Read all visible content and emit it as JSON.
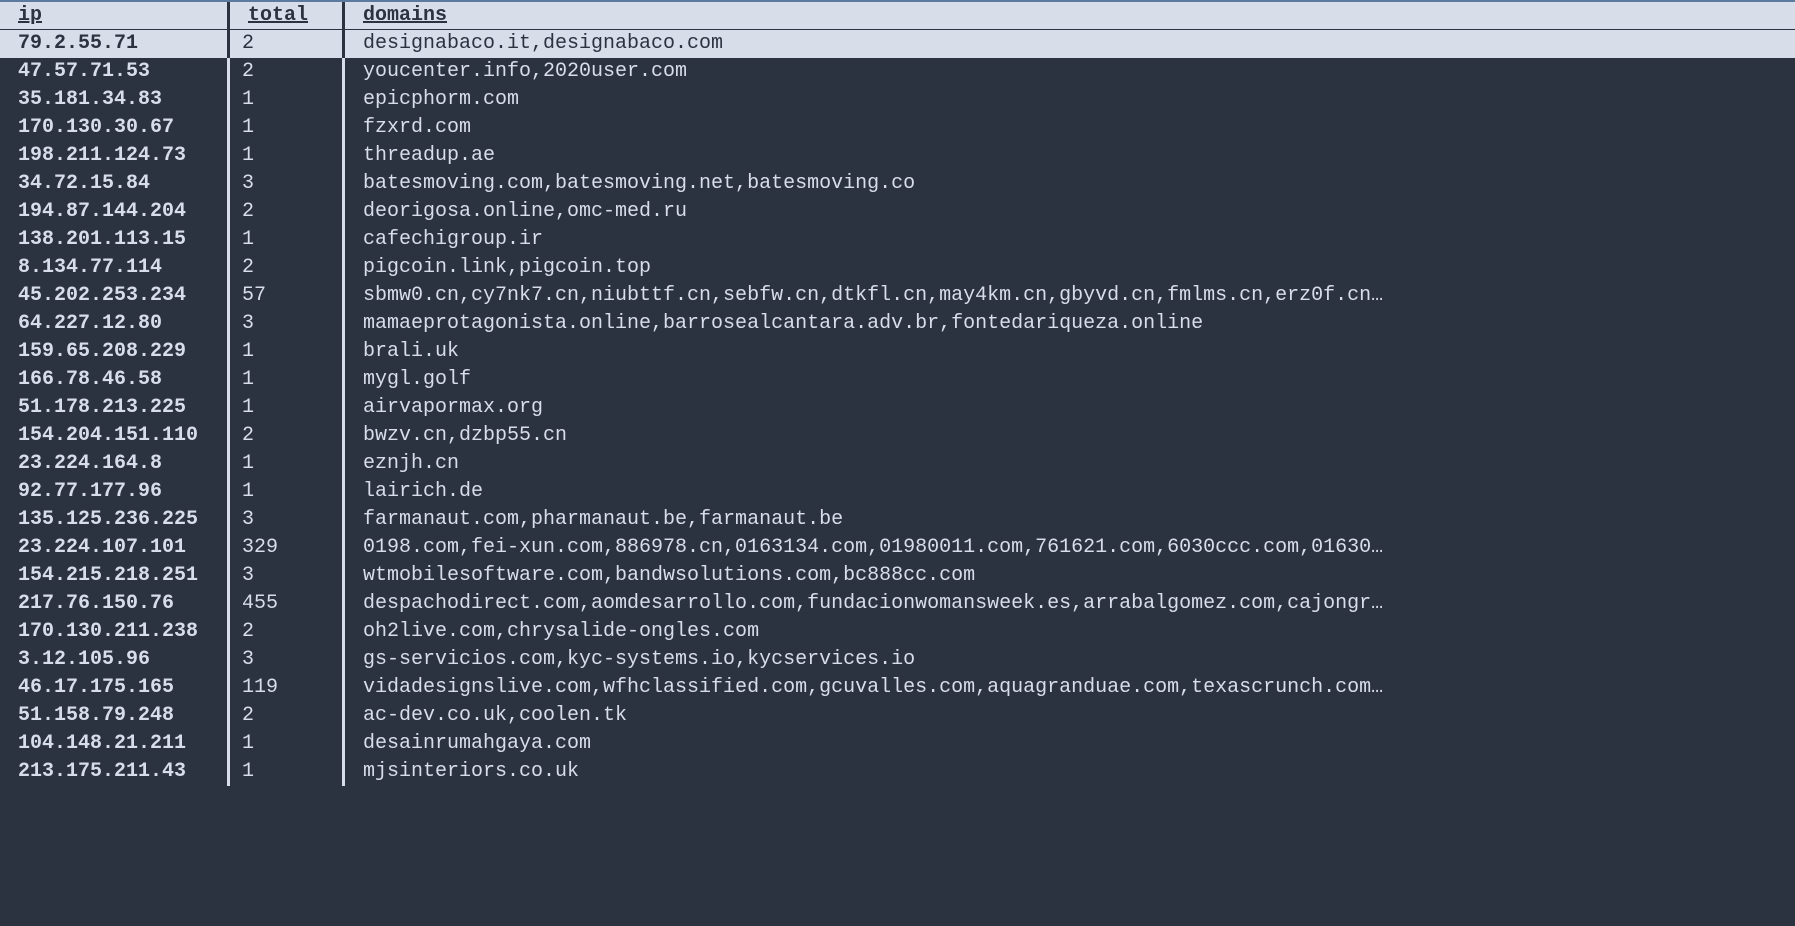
{
  "headers": {
    "ip": "ip",
    "total": "total",
    "domains": "domains"
  },
  "rows": [
    {
      "ip": "79.2.55.71",
      "total": "2",
      "domains": "designabaco.it,designabaco.com",
      "selected": true
    },
    {
      "ip": "47.57.71.53",
      "total": "2",
      "domains": "youcenter.info,2020user.com"
    },
    {
      "ip": "35.181.34.83",
      "total": "1",
      "domains": "epicphorm.com"
    },
    {
      "ip": "170.130.30.67",
      "total": "1",
      "domains": "fzxrd.com"
    },
    {
      "ip": "198.211.124.73",
      "total": "1",
      "domains": "threadup.ae"
    },
    {
      "ip": "34.72.15.84",
      "total": "3",
      "domains": "batesmoving.com,batesmoving.net,batesmoving.co"
    },
    {
      "ip": "194.87.144.204",
      "total": "2",
      "domains": "deorigosa.online,omc-med.ru"
    },
    {
      "ip": "138.201.113.15",
      "total": "1",
      "domains": "cafechigroup.ir"
    },
    {
      "ip": "8.134.77.114",
      "total": "2",
      "domains": "pigcoin.link,pigcoin.top"
    },
    {
      "ip": "45.202.253.234",
      "total": "57",
      "domains": "sbmw0.cn,cy7nk7.cn,niubttf.cn,sebfw.cn,dtkfl.cn,may4km.cn,gbyvd.cn,fmlms.cn,erz0f.cn…"
    },
    {
      "ip": "64.227.12.80",
      "total": "3",
      "domains": "mamaeprotagonista.online,barrosealcantara.adv.br,fontedariqueza.online"
    },
    {
      "ip": "159.65.208.229",
      "total": "1",
      "domains": "brali.uk"
    },
    {
      "ip": "166.78.46.58",
      "total": "1",
      "domains": "mygl.golf"
    },
    {
      "ip": "51.178.213.225",
      "total": "1",
      "domains": "airvapormax.org"
    },
    {
      "ip": "154.204.151.110",
      "total": "2",
      "domains": "bwzv.cn,dzbp55.cn"
    },
    {
      "ip": "23.224.164.8",
      "total": "1",
      "domains": "eznjh.cn"
    },
    {
      "ip": "92.77.177.96",
      "total": "1",
      "domains": "lairich.de"
    },
    {
      "ip": "135.125.236.225",
      "total": "3",
      "domains": "farmanaut.com,pharmanaut.be,farmanaut.be"
    },
    {
      "ip": "23.224.107.101",
      "total": "329",
      "domains": "0198.com,fei-xun.com,886978.cn,0163134.com,01980011.com,761621.com,6030ccc.com,01630…"
    },
    {
      "ip": "154.215.218.251",
      "total": "3",
      "domains": "wtmobilesoftware.com,bandwsolutions.com,bc888cc.com"
    },
    {
      "ip": "217.76.150.76",
      "total": "455",
      "domains": "despachodirect.com,aomdesarrollo.com,fundacionwomansweek.es,arrabalgomez.com,cajongr…"
    },
    {
      "ip": "170.130.211.238",
      "total": "2",
      "domains": "oh2live.com,chrysalide-ongles.com"
    },
    {
      "ip": "3.12.105.96",
      "total": "3",
      "domains": "gs-servicios.com,kyc-systems.io,kycservices.io"
    },
    {
      "ip": "46.17.175.165",
      "total": "119",
      "domains": "vidadesignslive.com,wfhclassified.com,gcuvalles.com,aquagranduae.com,texascrunch.com…"
    },
    {
      "ip": "51.158.79.248",
      "total": "2",
      "domains": "ac-dev.co.uk,coolen.tk"
    },
    {
      "ip": "104.148.21.211",
      "total": "1",
      "domains": "desainrumahgaya.com"
    },
    {
      "ip": "213.175.211.43",
      "total": "1",
      "domains": "mjsinteriors.co.uk"
    }
  ]
}
